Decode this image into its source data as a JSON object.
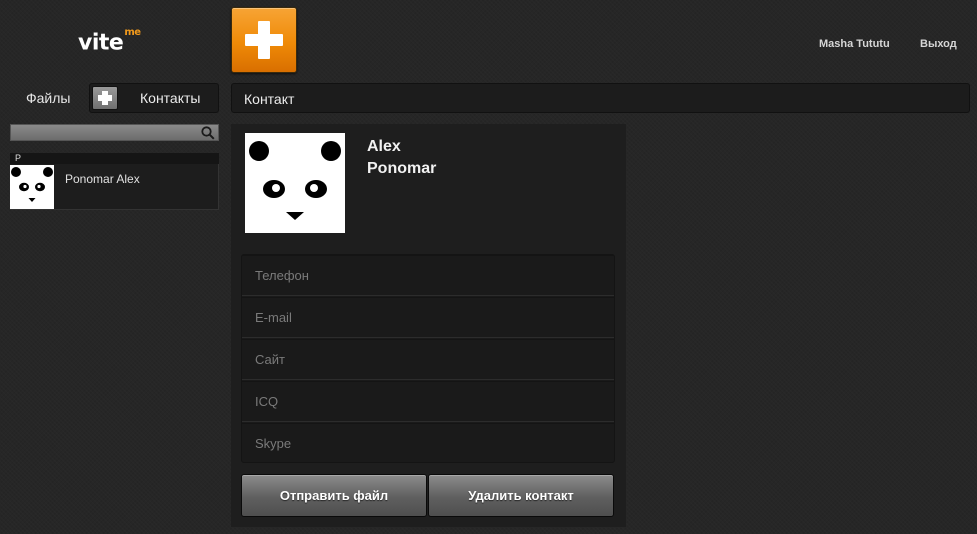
{
  "header": {
    "logo_text": "vite",
    "logo_sup": "me",
    "user_name": "Masha Tututu",
    "logout_label": "Выход"
  },
  "left_tabs": {
    "files_label": "Файлы",
    "contacts_label": "Контакты"
  },
  "search": {
    "value": "",
    "placeholder": ""
  },
  "contact_list": {
    "letter": "P",
    "items": [
      {
        "name": "Ponomar Alex"
      }
    ]
  },
  "content": {
    "header_label": "Контакт",
    "contact": {
      "first_name": "Alex",
      "last_name": "Ponomar"
    },
    "fields": [
      {
        "placeholder": "Телефон",
        "value": ""
      },
      {
        "placeholder": "E-mail",
        "value": ""
      },
      {
        "placeholder": "Сайт",
        "value": ""
      },
      {
        "placeholder": "ICQ",
        "value": ""
      },
      {
        "placeholder": "Skype",
        "value": ""
      }
    ],
    "send_file_label": "Отправить файл",
    "delete_contact_label": "Удалить контакт"
  },
  "colors": {
    "accent": "#ef8a07",
    "background": "#262626"
  }
}
